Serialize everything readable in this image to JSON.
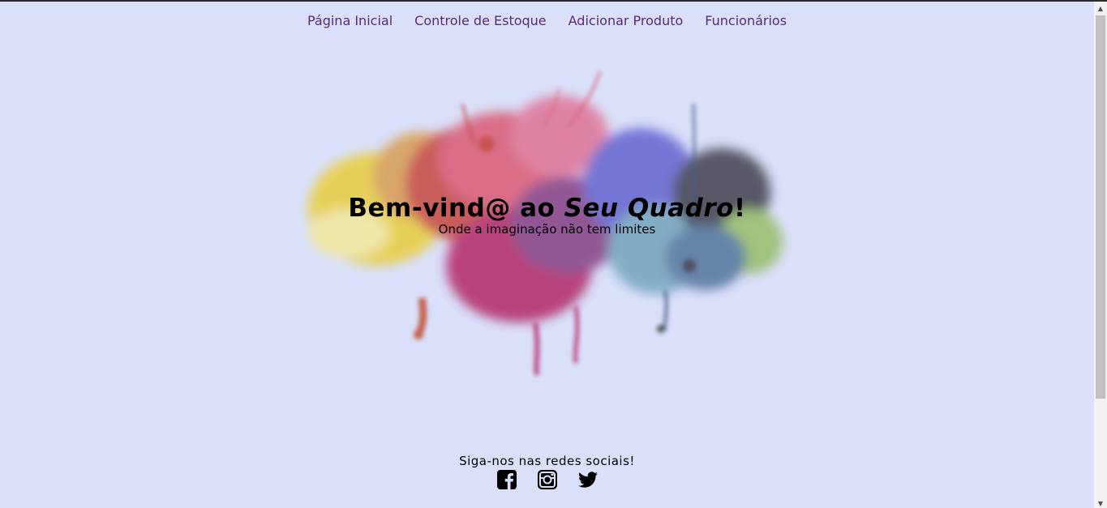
{
  "nav": {
    "items": [
      {
        "label": "Página Inicial"
      },
      {
        "label": "Controle de Estoque"
      },
      {
        "label": "Adicionar Produto"
      },
      {
        "label": "Funcionários"
      }
    ]
  },
  "hero": {
    "title_prefix": "Bem-vind@ ao ",
    "title_brand": "Seu Quadro",
    "title_suffix": "!",
    "subtitle": "Onde a imaginação não tem limites"
  },
  "footer": {
    "follow_text": "Siga-nos nas redes sociais!",
    "social": [
      {
        "icon": "facebook-icon"
      },
      {
        "icon": "instagram-icon"
      },
      {
        "icon": "twitter-icon"
      }
    ]
  },
  "colors": {
    "background": "#dae0fa",
    "nav_link": "#5a2a78"
  }
}
